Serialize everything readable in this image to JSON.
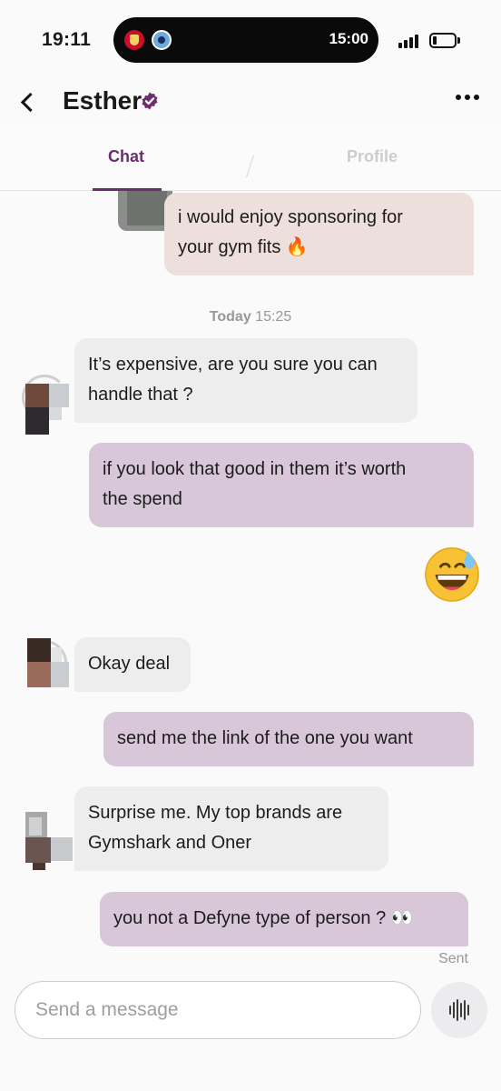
{
  "status_bar": {
    "time": "19:11",
    "live_activity_time": "15:00",
    "battery_level": 0.15
  },
  "header": {
    "contact_name": "Esther",
    "verified": true
  },
  "tabs": {
    "chat": "Chat",
    "profile": "Profile",
    "active": "chat"
  },
  "messages": [
    {
      "direction": "outgoing",
      "line1": "i would enjoy sponsoring for",
      "line2": "your gym fits 🔥"
    },
    {
      "direction": "incoming",
      "line1": "It’s expensive, are you sure you can",
      "line2": "handle that ?"
    },
    {
      "direction": "outgoing",
      "line1": "if you look that good in them it’s worth",
      "line2": "the spend"
    },
    {
      "direction": "outgoing",
      "emoji": "😅"
    },
    {
      "direction": "incoming",
      "line1": "Okay deal"
    },
    {
      "direction": "outgoing",
      "line1": "send me the link of the one you want"
    },
    {
      "direction": "incoming",
      "line1": "Surprise me. My top brands are",
      "line2": "Gymshark and Oner"
    },
    {
      "direction": "outgoing",
      "line1": "you not a Defyne type of person ? 👀"
    }
  ],
  "timestamp": {
    "day": "Today",
    "time": "15:25"
  },
  "delivery_status": "Sent",
  "composer": {
    "placeholder": "Send a message"
  },
  "colors": {
    "accent": "#6a2e6f",
    "outgoing_bubble": "#d7c7d9",
    "incoming_bubble": "#ededee",
    "sponsor_bubble": "#ecdfdc"
  },
  "icons": {
    "back": "chevron-left-icon",
    "verified": "verified-badge-icon",
    "more": "more-horizontal-icon",
    "voice": "voice-waveform-icon"
  }
}
